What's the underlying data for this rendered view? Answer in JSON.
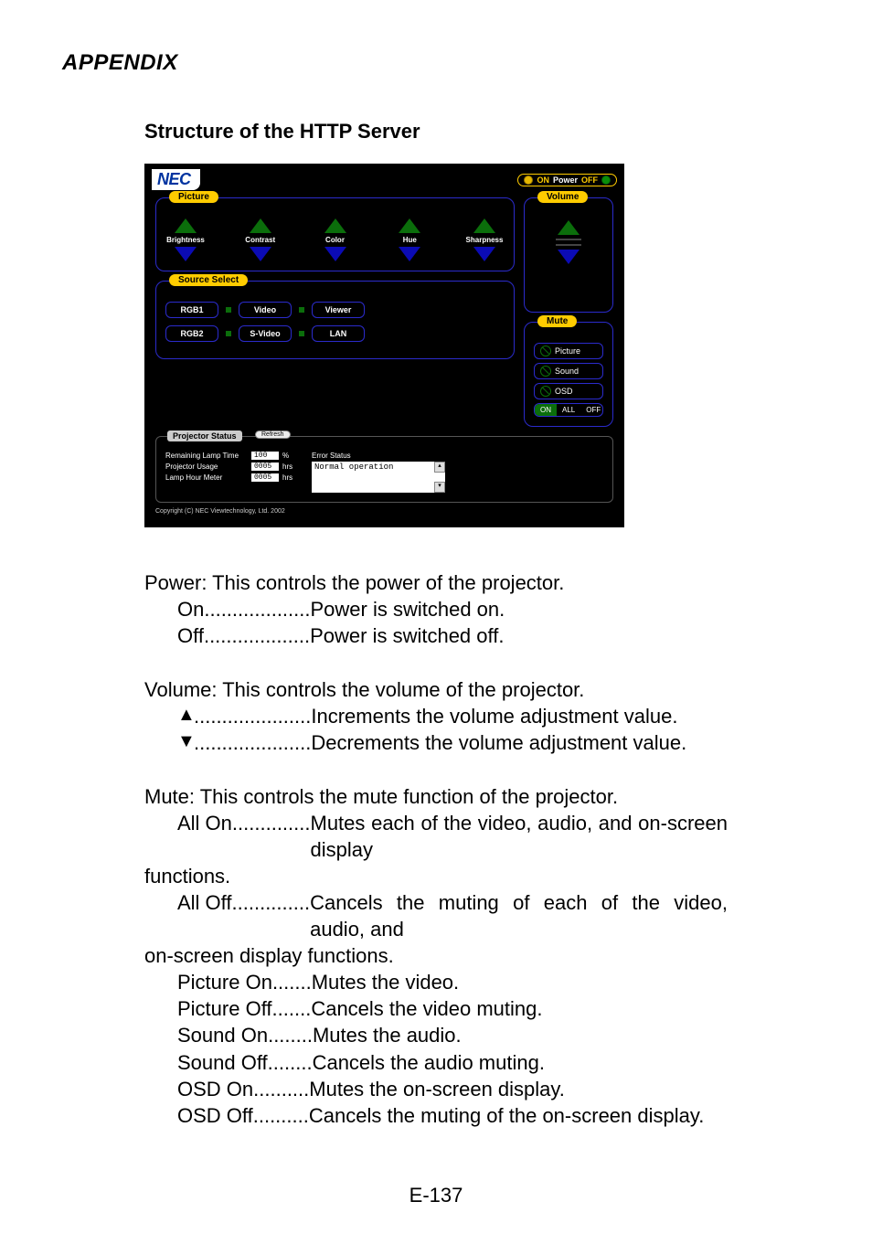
{
  "header": "APPENDIX",
  "section_title": "Structure of the HTTP Server",
  "ui": {
    "brand": "NEC",
    "power": {
      "on": "ON",
      "label": "Power",
      "off": "OFF"
    },
    "picture": {
      "title": "Picture",
      "items": [
        "Brightness",
        "Contrast",
        "Color",
        "Hue",
        "Sharpness"
      ]
    },
    "volume": {
      "title": "Volume"
    },
    "source": {
      "title": "Source Select",
      "row1": [
        "RGB1",
        "Video",
        "Viewer"
      ],
      "row2": [
        "RGB2",
        "S-Video",
        "LAN"
      ]
    },
    "mute": {
      "title": "Mute",
      "items": [
        "Picture",
        "Sound",
        "OSD"
      ],
      "all_on": "ON",
      "all_label": "ALL",
      "all_off": "OFF"
    },
    "status": {
      "title": "Projector Status",
      "refresh": "Refresh",
      "rows": [
        {
          "label": "Remaining Lamp Time",
          "value": "100",
          "unit": "%"
        },
        {
          "label": "Projector Usage",
          "value": "0005",
          "unit": "hrs"
        },
        {
          "label": "Lamp Hour Meter",
          "value": "0005",
          "unit": "hrs"
        }
      ],
      "error_label": "Error Status",
      "error_value": "Normal operation"
    },
    "copyright": "Copyright (C) NEC Viewtechnology, Ltd. 2002"
  },
  "text": {
    "power_head": "Power: This controls the power of the projector.",
    "power_on_term": "On ",
    "power_on_dots": "................... ",
    "power_on_def": "Power is switched on.",
    "power_off_term": "Off ",
    "power_off_dots": "................... ",
    "power_off_def": "Power is switched off.",
    "volume_head": "Volume: This controls the volume of the projector.",
    "vol_up_dots": " ..................... ",
    "vol_up_def": "Increments the volume adjustment value.",
    "vol_dn_dots": " ..................... ",
    "vol_dn_def": "Decrements the volume adjustment value.",
    "mute_head": "Mute: This controls the mute function of the projector.",
    "mute_allon_term": "All On ",
    "mute_allon_dots": ".............. ",
    "mute_allon_def": "Mutes each of the video, audio, and on-screen display",
    "mute_allon_def2": "functions.",
    "mute_alloff_term": "All Off ",
    "mute_alloff_dots": ".............. ",
    "mute_alloff_def": "Cancels the muting of each of the video, audio, and",
    "mute_alloff_def2": "on-screen display functions.",
    "mute_picon_term": "Picture On ",
    "mute_picon_dots": "....... ",
    "mute_picon_def": "Mutes the video.",
    "mute_picoff_term": "Picture Off ",
    "mute_picoff_dots": "....... ",
    "mute_picoff_def": "Cancels the video muting.",
    "mute_sndon_term": "Sound On ",
    "mute_sndon_dots": "........ ",
    "mute_sndon_def": "Mutes the audio.",
    "mute_sndoff_term": "Sound Off ",
    "mute_sndoff_dots": "........ ",
    "mute_sndoff_def": "Cancels the audio muting.",
    "mute_osdon_term": "OSD On ",
    "mute_osdon_dots": ".......... ",
    "mute_osdon_def": "Mutes the on-screen display.",
    "mute_osdoff_term": "OSD Off ",
    "mute_osdoff_dots": ".......... ",
    "mute_osdoff_def": "Cancels the muting of the on-screen display."
  },
  "page_num": "E-137"
}
